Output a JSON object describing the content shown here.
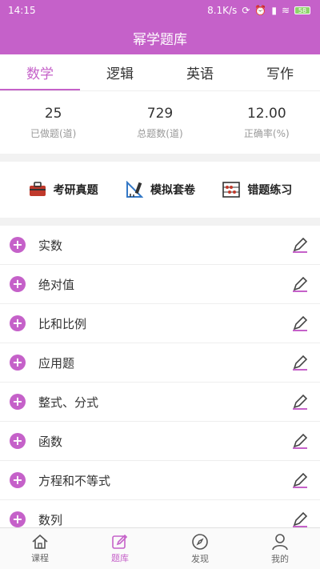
{
  "status": {
    "time": "14:15",
    "network": "8.1K/s",
    "battery": "58"
  },
  "app": {
    "title": "幂学题库"
  },
  "tabs": [
    {
      "label": "数学",
      "active": true
    },
    {
      "label": "逻辑",
      "active": false
    },
    {
      "label": "英语",
      "active": false
    },
    {
      "label": "写作",
      "active": false
    }
  ],
  "stats": [
    {
      "value": "25",
      "label": "已做题(道)"
    },
    {
      "value": "729",
      "label": "总题数(道)"
    },
    {
      "value": "12.00",
      "label": "正确率(%)"
    }
  ],
  "shortcuts": [
    {
      "label": "考研真题",
      "icon": "briefcase-icon"
    },
    {
      "label": "模拟套卷",
      "icon": "ruler-icon"
    },
    {
      "label": "错题练习",
      "icon": "abacus-icon"
    }
  ],
  "topics": [
    {
      "label": "实数"
    },
    {
      "label": "绝对值"
    },
    {
      "label": "比和比例"
    },
    {
      "label": "应用题"
    },
    {
      "label": "整式、分式"
    },
    {
      "label": "函数"
    },
    {
      "label": "方程和不等式"
    },
    {
      "label": "数列"
    }
  ],
  "nav": [
    {
      "label": "课程",
      "icon": "home-icon",
      "active": false
    },
    {
      "label": "题库",
      "icon": "edit-icon",
      "active": true
    },
    {
      "label": "发现",
      "icon": "compass-icon",
      "active": false
    },
    {
      "label": "我的",
      "icon": "person-icon",
      "active": false
    }
  ],
  "colors": {
    "accent": "#c561c9"
  }
}
